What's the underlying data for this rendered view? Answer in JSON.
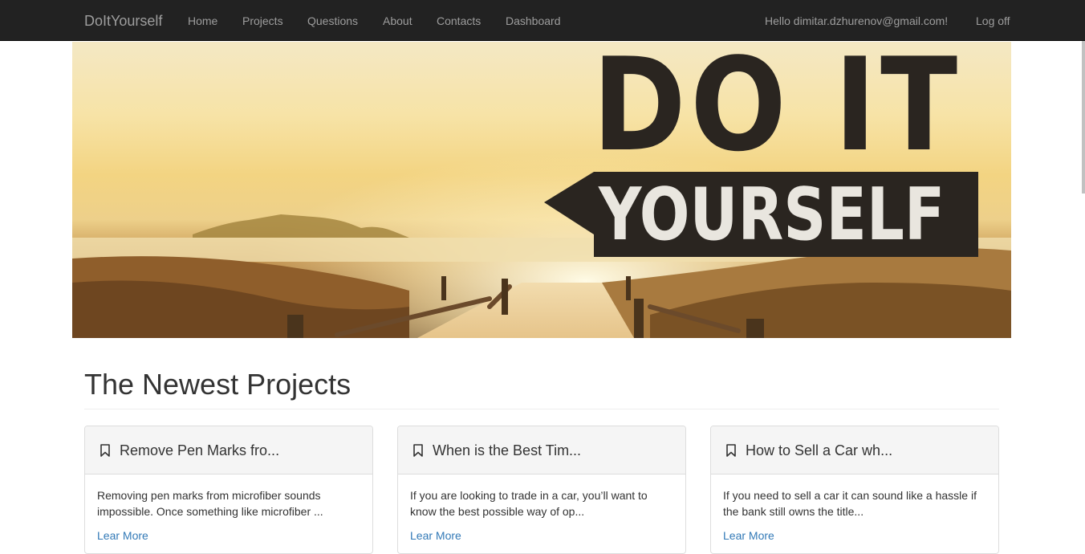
{
  "navbar": {
    "brand": "DoItYourself",
    "links": [
      "Home",
      "Projects",
      "Questions",
      "About",
      "Contacts",
      "Dashboard"
    ],
    "greeting": "Hello dimitar.dzhurenov@gmail.com!",
    "logoff": "Log off"
  },
  "hero": {
    "line1": "DO IT",
    "line2": "YOURSELF"
  },
  "section": {
    "title": "The Newest Projects"
  },
  "projects": [
    {
      "title": "Remove Pen Marks fro...",
      "text": "Removing pen marks from microfiber sounds impossible. Once something like microfiber ...",
      "link": "Lear More"
    },
    {
      "title": "When is the Best Tim...",
      "text": "If you are looking to trade in a car, you’ll want to know the best possible way of op...",
      "link": "Lear More"
    },
    {
      "title": "How to Sell a Car wh...",
      "text": "If you need to sell a car it can sound like a hassle if the bank still owns the title...",
      "link": "Lear More"
    }
  ],
  "colors": {
    "navbar": "#222222",
    "link": "#337ab7",
    "navText": "#9d9d9d"
  },
  "icons": {
    "card": "bookmark-icon"
  }
}
